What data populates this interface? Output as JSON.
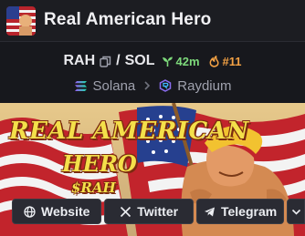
{
  "header": {
    "title": "Real American Hero"
  },
  "pair": {
    "base": "RAH",
    "separator": "/",
    "quote": "SOL",
    "age": "42m",
    "rank": "#11"
  },
  "chain": {
    "network": "Solana",
    "dex": "Raydium"
  },
  "banner": {
    "line1": "REAL AMERICAN",
    "line2": "HERO",
    "line3": "$RAH"
  },
  "links": {
    "website": "Website",
    "twitter": "Twitter",
    "telegram": "Telegram"
  },
  "colors": {
    "age": "#7dd97b",
    "rank": "#f3a144",
    "background": "#17181d",
    "button": "#2a2b33"
  },
  "icons": [
    "flag-avatar",
    "copy-icon",
    "sprout-icon",
    "flame-icon",
    "solana-icon",
    "chevron-right-icon",
    "raydium-icon",
    "globe-icon",
    "x-icon",
    "telegram-icon",
    "chevron-down-icon"
  ]
}
